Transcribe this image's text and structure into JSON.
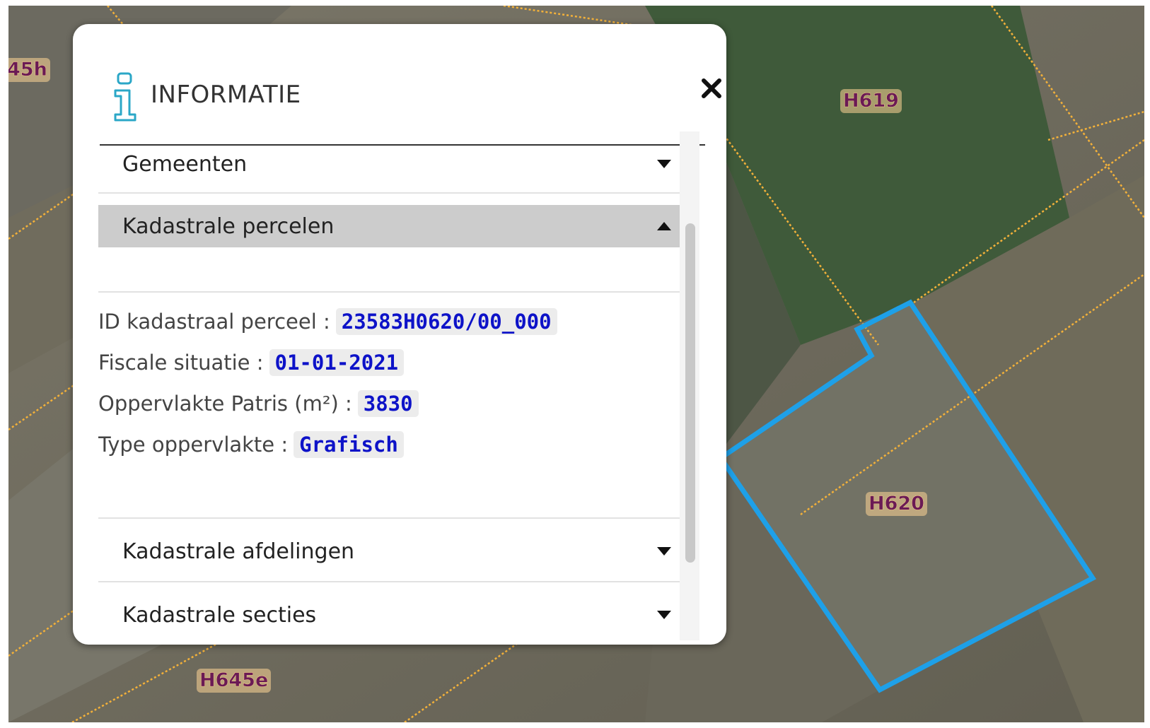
{
  "map": {
    "parcels": [
      {
        "label": "H619"
      },
      {
        "label": "H620"
      },
      {
        "label": "H645e"
      },
      {
        "label": "45h"
      }
    ],
    "colors": {
      "boundary": "#f3b13a",
      "selection": "#1ea0e8",
      "label_text": "#6a1a55",
      "label_halo": "#ffd690"
    }
  },
  "panel": {
    "title": "INFORMATIE",
    "icon": "info-icon",
    "close_icon": "close-icon"
  },
  "accordion": {
    "sections": [
      {
        "label": "Gemeenten",
        "expanded": false
      },
      {
        "label": "Kadastrale percelen",
        "expanded": true
      },
      {
        "label": "Kadastrale afdelingen",
        "expanded": false
      },
      {
        "label": "Kadastrale secties",
        "expanded": false
      }
    ],
    "attributes": [
      {
        "key": "ID kadastraal perceel :",
        "value": "23583H0620/00_000"
      },
      {
        "key": "Fiscale situatie :",
        "value": "01-01-2021"
      },
      {
        "key": "Oppervlakte Patris (m²) :",
        "value": "3830"
      },
      {
        "key": "Type oppervlakte :",
        "value": "Grafisch"
      }
    ]
  }
}
